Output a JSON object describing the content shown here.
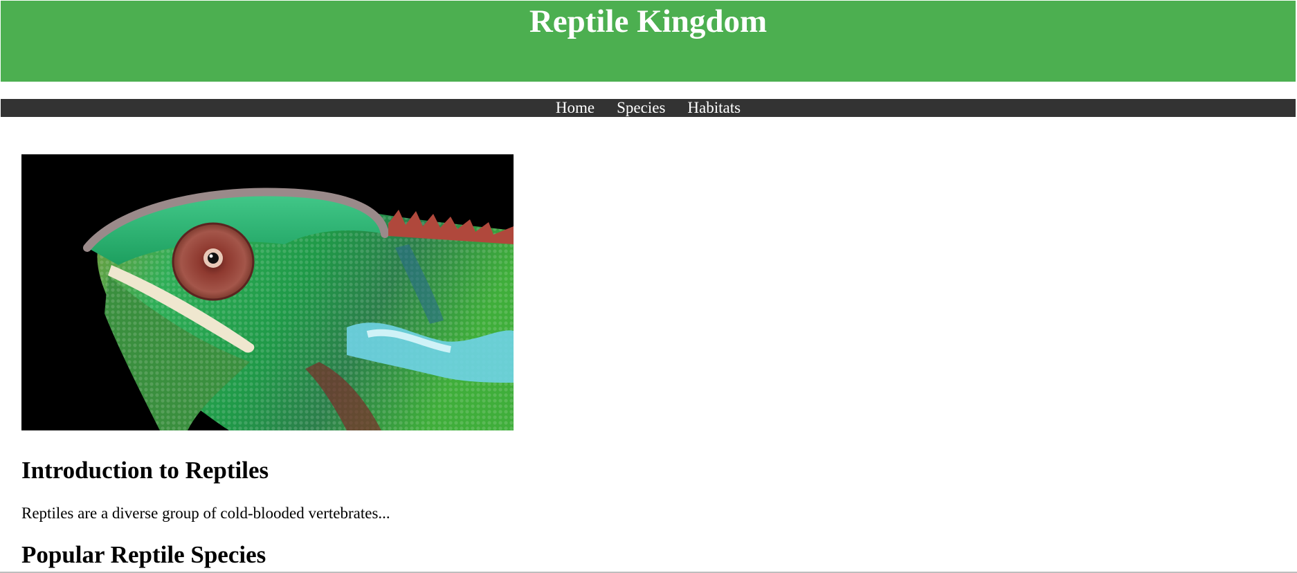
{
  "header": {
    "title": "Reptile Kingdom"
  },
  "nav": {
    "items": [
      "Home",
      "Species",
      "Habitats"
    ]
  },
  "main": {
    "intro_heading": "Introduction to Reptiles",
    "intro_text": "Reptiles are a diverse group of cold-blooded vertebrates...",
    "species_heading": "Popular Reptile Species"
  },
  "colors": {
    "header_bg": "#4caf50",
    "nav_bg": "#333333",
    "header_text": "#ffffff"
  },
  "icons": {
    "hero_image": "chameleon-photo"
  }
}
